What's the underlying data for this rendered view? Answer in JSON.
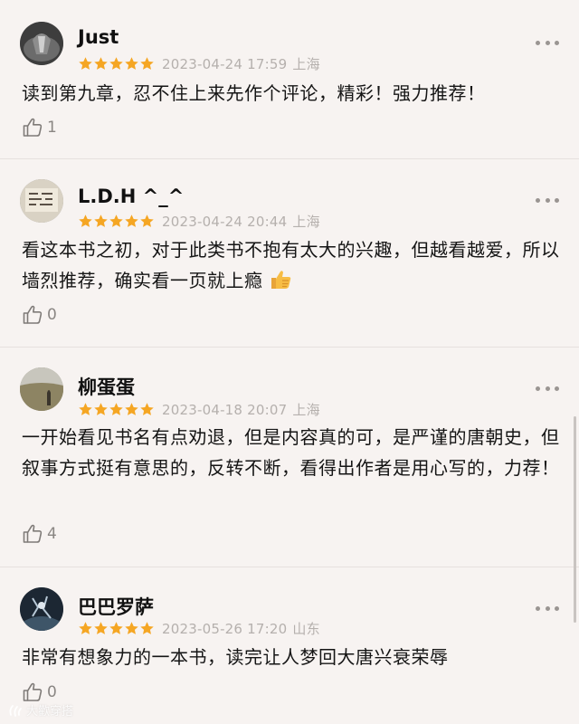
{
  "reviews": [
    {
      "username": "Just",
      "rating": 5,
      "date": "2023-04-24 17:59",
      "location": "上海",
      "content": "读到第九章，忍不住上来先作个评论，精彩！强力推荐！",
      "has_thumb_emoji": false,
      "likes": "1"
    },
    {
      "username": "L.D.H ^_^",
      "rating": 5,
      "date": "2023-04-24 20:44",
      "location": "上海",
      "content": "看这本书之初，对于此类书不抱有太大的兴趣，但越看越爱，所以墙烈推荐，确实看一页就上瘾",
      "has_thumb_emoji": true,
      "likes": "0"
    },
    {
      "username": "柳蛋蛋",
      "rating": 5,
      "date": "2023-04-18 20:07",
      "location": "上海",
      "content": "一开始看见书名有点劝退，但是内容真的可，是严谨的唐朝史，但叙事方式挺有意思的，反转不断，看得出作者是用心写的，力荐！",
      "has_thumb_emoji": false,
      "likes": "4"
    },
    {
      "username": "巴巴罗萨",
      "rating": 5,
      "date": "2023-05-26 17:20",
      "location": "山东",
      "content": "非常有想象力的一本书，读完让人梦回大唐兴衰荣辱",
      "has_thumb_emoji": false,
      "likes": "0"
    }
  ],
  "colors": {
    "star": "#f5a623",
    "background": "#f7f3f1",
    "meta": "#b5b0ad"
  },
  "icons": {
    "more": "more-dots-icon",
    "like": "thumbs-up-outline-icon",
    "emoji": "thumbs-up-emoji-icon",
    "watermark_logo": "watermark-logo-icon"
  },
  "watermark": {
    "text": "大歡穿搭"
  }
}
